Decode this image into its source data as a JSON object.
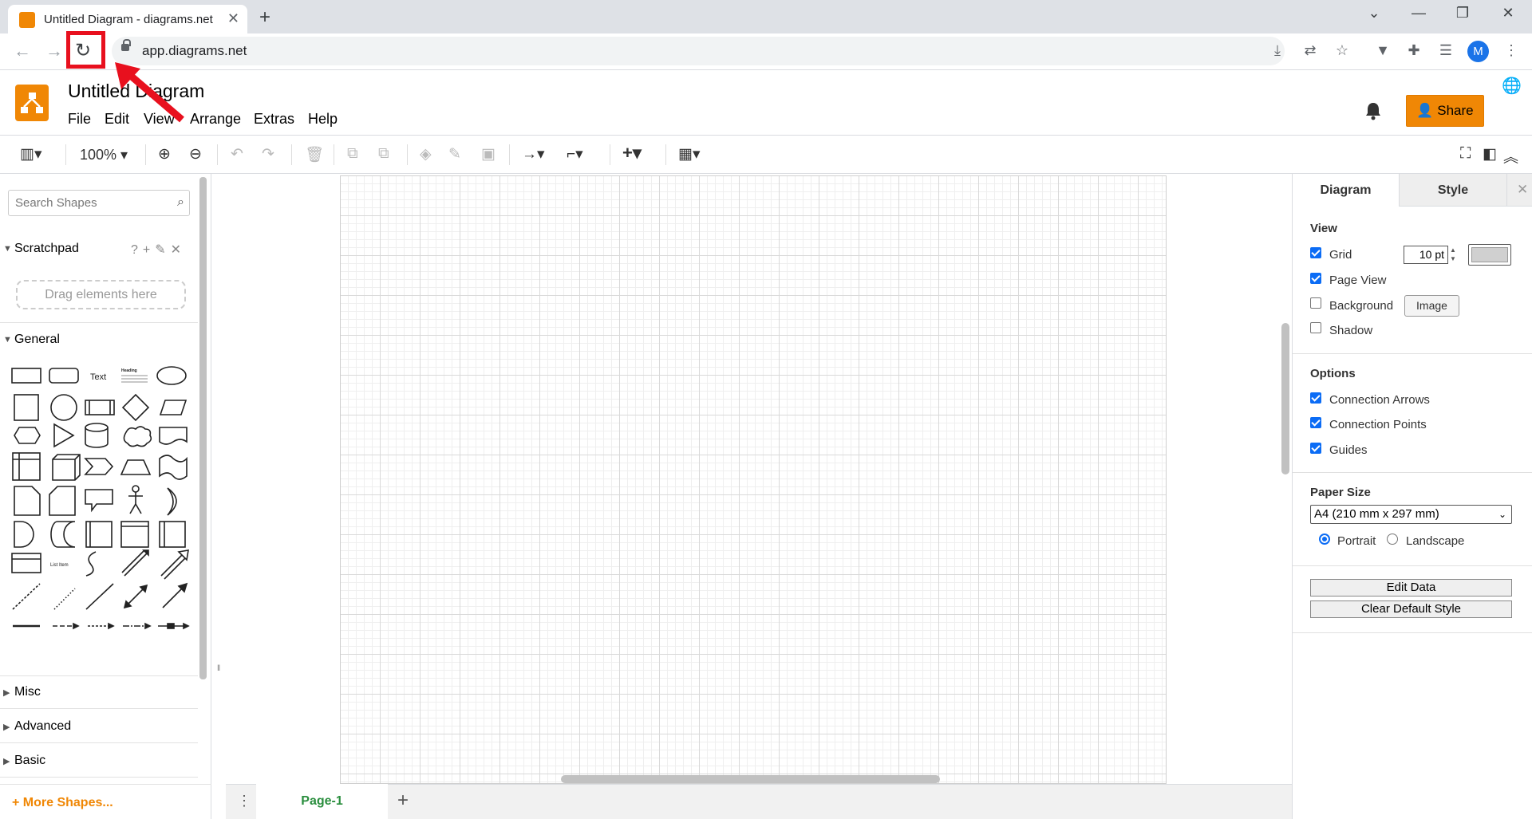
{
  "browser": {
    "tab_title": "Untitled Diagram - diagrams.net",
    "url": "app.diagrams.net",
    "profile_initial": "M"
  },
  "app": {
    "title": "Untitled Diagram",
    "menu": [
      "File",
      "Edit",
      "View",
      "Arrange",
      "Extras",
      "Help"
    ],
    "share_label": "Share",
    "brand_color": "#f08705"
  },
  "toolbar": {
    "zoom": "100%"
  },
  "sidebar": {
    "search_placeholder": "Search Shapes",
    "scratchpad": "Scratchpad",
    "drop_hint": "Drag elements here",
    "general": "General",
    "shape_text_label": "Text",
    "shape_heading_label": "Heading",
    "shape_listitem_label": "List Item",
    "sections": [
      "Misc",
      "Advanced",
      "Basic"
    ],
    "more_shapes": "+ More Shapes..."
  },
  "pages": {
    "current": "Page-1"
  },
  "format_panel": {
    "tabs": [
      "Diagram",
      "Style"
    ],
    "view_title": "View",
    "grid_label": "Grid",
    "grid_size": "10 pt",
    "page_view_label": "Page View",
    "background_label": "Background",
    "image_button": "Image",
    "shadow_label": "Shadow",
    "options_title": "Options",
    "connection_arrows": "Connection Arrows",
    "connection_points": "Connection Points",
    "guides": "Guides",
    "paper_size_title": "Paper Size",
    "paper_size": "A4 (210 mm x 297 mm)",
    "portrait": "Portrait",
    "landscape": "Landscape",
    "edit_data": "Edit Data",
    "clear_default_style": "Clear Default Style",
    "checked": {
      "grid": true,
      "page_view": true,
      "background": false,
      "shadow": false,
      "connection_arrows": true,
      "connection_points": true,
      "guides": true
    },
    "orientation": "portrait"
  },
  "annotation": {
    "color": "#e8101e"
  }
}
